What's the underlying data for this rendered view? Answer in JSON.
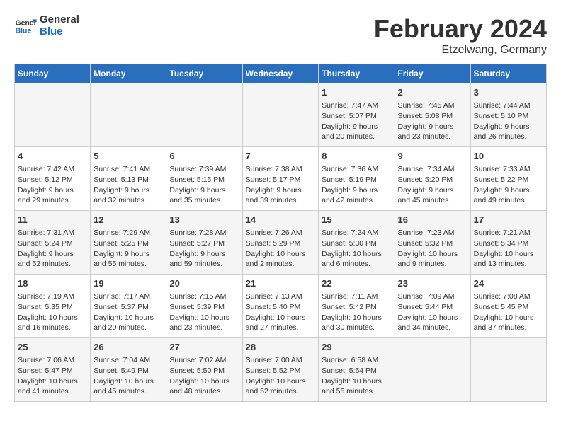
{
  "header": {
    "logo_line1": "General",
    "logo_line2": "Blue",
    "title": "February 2024",
    "subtitle": "Etzelwang, Germany"
  },
  "days_of_week": [
    "Sunday",
    "Monday",
    "Tuesday",
    "Wednesday",
    "Thursday",
    "Friday",
    "Saturday"
  ],
  "weeks": [
    [
      {
        "day": "",
        "info": ""
      },
      {
        "day": "",
        "info": ""
      },
      {
        "day": "",
        "info": ""
      },
      {
        "day": "",
        "info": ""
      },
      {
        "day": "1",
        "info": "Sunrise: 7:47 AM\nSunset: 5:07 PM\nDaylight: 9 hours\nand 20 minutes."
      },
      {
        "day": "2",
        "info": "Sunrise: 7:45 AM\nSunset: 5:08 PM\nDaylight: 9 hours\nand 23 minutes."
      },
      {
        "day": "3",
        "info": "Sunrise: 7:44 AM\nSunset: 5:10 PM\nDaylight: 9 hours\nand 26 minutes."
      }
    ],
    [
      {
        "day": "4",
        "info": "Sunrise: 7:42 AM\nSunset: 5:12 PM\nDaylight: 9 hours\nand 29 minutes."
      },
      {
        "day": "5",
        "info": "Sunrise: 7:41 AM\nSunset: 5:13 PM\nDaylight: 9 hours\nand 32 minutes."
      },
      {
        "day": "6",
        "info": "Sunrise: 7:39 AM\nSunset: 5:15 PM\nDaylight: 9 hours\nand 35 minutes."
      },
      {
        "day": "7",
        "info": "Sunrise: 7:38 AM\nSunset: 5:17 PM\nDaylight: 9 hours\nand 39 minutes."
      },
      {
        "day": "8",
        "info": "Sunrise: 7:36 AM\nSunset: 5:19 PM\nDaylight: 9 hours\nand 42 minutes."
      },
      {
        "day": "9",
        "info": "Sunrise: 7:34 AM\nSunset: 5:20 PM\nDaylight: 9 hours\nand 45 minutes."
      },
      {
        "day": "10",
        "info": "Sunrise: 7:33 AM\nSunset: 5:22 PM\nDaylight: 9 hours\nand 49 minutes."
      }
    ],
    [
      {
        "day": "11",
        "info": "Sunrise: 7:31 AM\nSunset: 5:24 PM\nDaylight: 9 hours\nand 52 minutes."
      },
      {
        "day": "12",
        "info": "Sunrise: 7:29 AM\nSunset: 5:25 PM\nDaylight: 9 hours\nand 55 minutes."
      },
      {
        "day": "13",
        "info": "Sunrise: 7:28 AM\nSunset: 5:27 PM\nDaylight: 9 hours\nand 59 minutes."
      },
      {
        "day": "14",
        "info": "Sunrise: 7:26 AM\nSunset: 5:29 PM\nDaylight: 10 hours\nand 2 minutes."
      },
      {
        "day": "15",
        "info": "Sunrise: 7:24 AM\nSunset: 5:30 PM\nDaylight: 10 hours\nand 6 minutes."
      },
      {
        "day": "16",
        "info": "Sunrise: 7:23 AM\nSunset: 5:32 PM\nDaylight: 10 hours\nand 9 minutes."
      },
      {
        "day": "17",
        "info": "Sunrise: 7:21 AM\nSunset: 5:34 PM\nDaylight: 10 hours\nand 13 minutes."
      }
    ],
    [
      {
        "day": "18",
        "info": "Sunrise: 7:19 AM\nSunset: 5:35 PM\nDaylight: 10 hours\nand 16 minutes."
      },
      {
        "day": "19",
        "info": "Sunrise: 7:17 AM\nSunset: 5:37 PM\nDaylight: 10 hours\nand 20 minutes."
      },
      {
        "day": "20",
        "info": "Sunrise: 7:15 AM\nSunset: 5:39 PM\nDaylight: 10 hours\nand 23 minutes."
      },
      {
        "day": "21",
        "info": "Sunrise: 7:13 AM\nSunset: 5:40 PM\nDaylight: 10 hours\nand 27 minutes."
      },
      {
        "day": "22",
        "info": "Sunrise: 7:11 AM\nSunset: 5:42 PM\nDaylight: 10 hours\nand 30 minutes."
      },
      {
        "day": "23",
        "info": "Sunrise: 7:09 AM\nSunset: 5:44 PM\nDaylight: 10 hours\nand 34 minutes."
      },
      {
        "day": "24",
        "info": "Sunrise: 7:08 AM\nSunset: 5:45 PM\nDaylight: 10 hours\nand 37 minutes."
      }
    ],
    [
      {
        "day": "25",
        "info": "Sunrise: 7:06 AM\nSunset: 5:47 PM\nDaylight: 10 hours\nand 41 minutes."
      },
      {
        "day": "26",
        "info": "Sunrise: 7:04 AM\nSunset: 5:49 PM\nDaylight: 10 hours\nand 45 minutes."
      },
      {
        "day": "27",
        "info": "Sunrise: 7:02 AM\nSunset: 5:50 PM\nDaylight: 10 hours\nand 48 minutes."
      },
      {
        "day": "28",
        "info": "Sunrise: 7:00 AM\nSunset: 5:52 PM\nDaylight: 10 hours\nand 52 minutes."
      },
      {
        "day": "29",
        "info": "Sunrise: 6:58 AM\nSunset: 5:54 PM\nDaylight: 10 hours\nand 55 minutes."
      },
      {
        "day": "",
        "info": ""
      },
      {
        "day": "",
        "info": ""
      }
    ]
  ]
}
